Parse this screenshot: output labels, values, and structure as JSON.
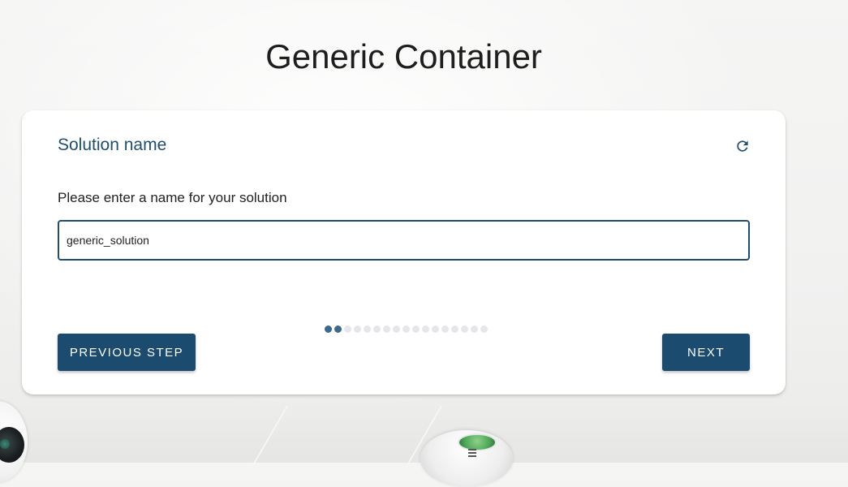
{
  "page": {
    "title": "Generic Container"
  },
  "wizard": {
    "step_title": "Solution name",
    "refresh_icon": "refresh-icon",
    "prompt": "Please enter a name for your solution",
    "name_input": {
      "value": "generic_solution",
      "placeholder": ""
    },
    "progress": {
      "current_step": 2,
      "total_steps": 17
    },
    "previous_label": "PREVIOUS STEP",
    "next_label": "NEXT"
  },
  "colors": {
    "accent": "#1b4b6e",
    "title_text": "#1f4e6e",
    "dot_done": "#3d6a8c",
    "dot_pending": "#e4e6e9"
  }
}
